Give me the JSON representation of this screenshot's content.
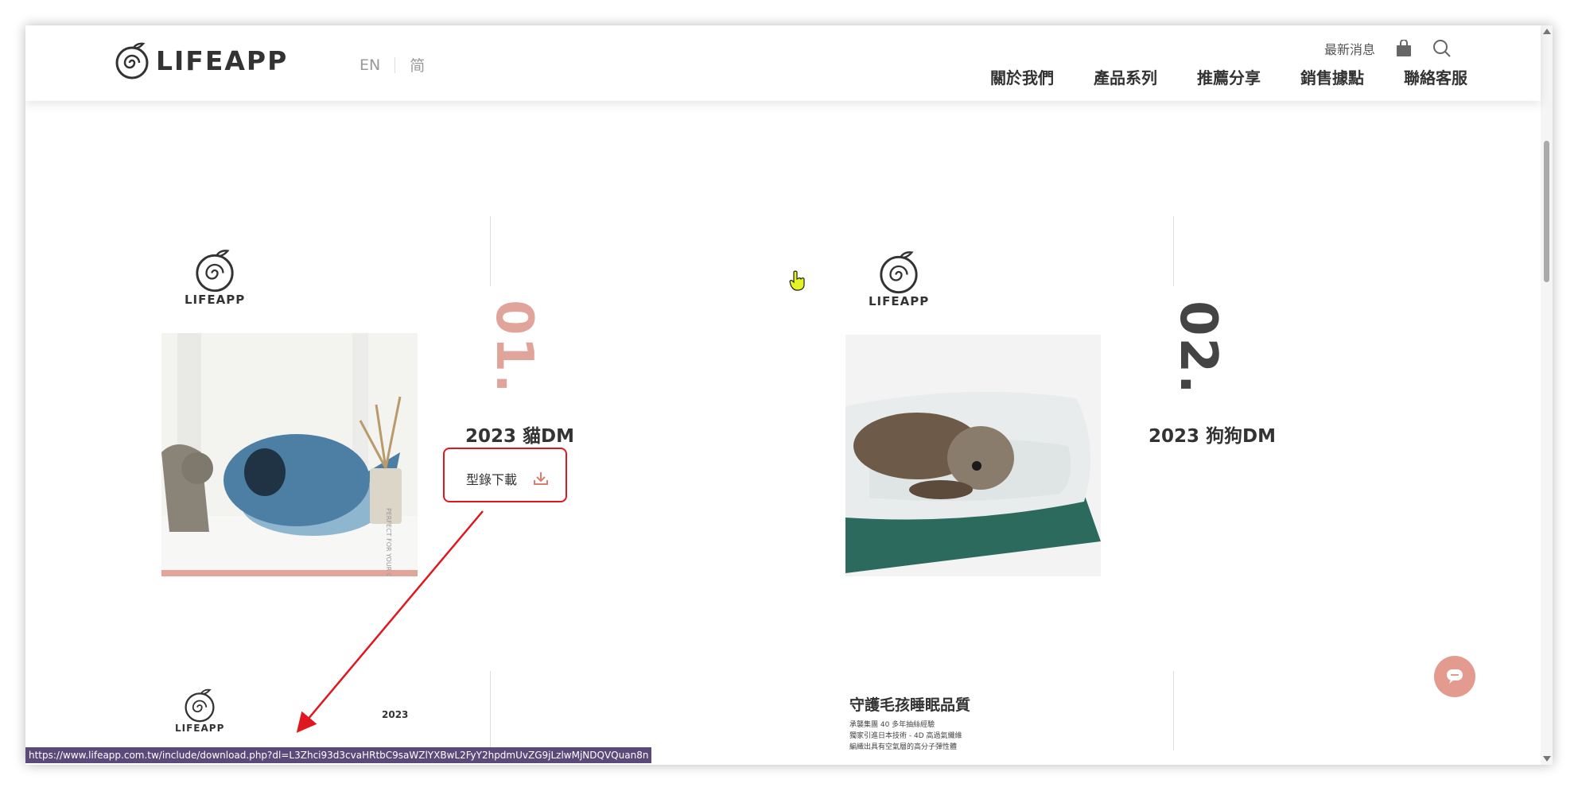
{
  "header": {
    "brand": "LIFEAPP",
    "lang_en": "EN",
    "lang_sc": "简",
    "news": "最新消息",
    "nav": [
      "關於我們",
      "產品系列",
      "推薦分享",
      "銷售據點",
      "聯絡客服"
    ]
  },
  "cards": [
    {
      "brand": "LIFEAPP",
      "number": "01.",
      "title": "2023 貓DM",
      "download": "型錄下載",
      "photo_caption": "PERFECT FOR YOUR CAT",
      "number_color": "#e0a49a"
    },
    {
      "brand": "LIFEAPP",
      "number": "02.",
      "title": "2023 狗狗DM",
      "number_color": "#444444"
    },
    {
      "brand": "LIFEAPP",
      "year": "2023"
    },
    {
      "headline": "守護毛孩睡眠品質",
      "lines": [
        "承襲集團 40 多年抽絲經驗",
        "獨家引進日本技術 - 4D 高過氣纖維",
        "編織出具有空氣層的高分子彈性體"
      ]
    }
  ],
  "status_url": "https://www.lifeapp.com.tw/include/download.php?dl=L3Zhci93d3cvaHRtbC9saWZlYXBwL2FyY2hpdmUvZG9jLzlwMjNDQVQuan8n",
  "colors": {
    "accent": "#e39a8f",
    "annotation": "#e0171f",
    "status_bg": "#5a4a7a"
  }
}
